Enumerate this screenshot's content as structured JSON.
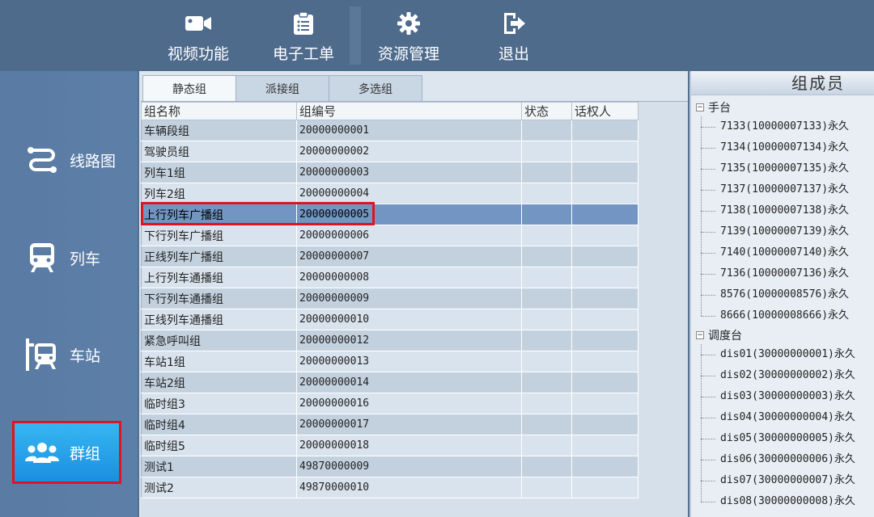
{
  "topbar": {
    "buttons": [
      {
        "label": "视频功能",
        "icon": "video-camera-icon"
      },
      {
        "label": "电子工单",
        "icon": "clipboard-icon"
      },
      {
        "label": "资源管理",
        "icon": "gear-icon"
      },
      {
        "label": "退出",
        "icon": "exit-icon"
      }
    ]
  },
  "sidebar": {
    "items": [
      {
        "label": "线路图",
        "icon": "route-icon"
      },
      {
        "label": "列车",
        "icon": "train-icon"
      },
      {
        "label": "车站",
        "icon": "station-icon"
      },
      {
        "label": "群组",
        "icon": "group-users-icon",
        "active": true
      }
    ]
  },
  "tabs": [
    {
      "label": "静态组",
      "active": true
    },
    {
      "label": "派接组"
    },
    {
      "label": "多选组"
    }
  ],
  "table": {
    "columns": [
      "组名称",
      "组编号",
      "状态",
      "话权人"
    ],
    "rows": [
      {
        "name": "车辆段组",
        "id": "20000000001",
        "status": "",
        "speaker": ""
      },
      {
        "name": "驾驶员组",
        "id": "20000000002",
        "status": "",
        "speaker": ""
      },
      {
        "name": "列车1组",
        "id": "20000000003",
        "status": "",
        "speaker": ""
      },
      {
        "name": "列车2组",
        "id": "20000000004",
        "status": "",
        "speaker": ""
      },
      {
        "name": "上行列车广播组",
        "id": "20000000005",
        "status": "",
        "speaker": "",
        "selected": true
      },
      {
        "name": "下行列车广播组",
        "id": "20000000006",
        "status": "",
        "speaker": ""
      },
      {
        "name": "正线列车广播组",
        "id": "20000000007",
        "status": "",
        "speaker": ""
      },
      {
        "name": "上行列车通播组",
        "id": "20000000008",
        "status": "",
        "speaker": ""
      },
      {
        "name": "下行列车通播组",
        "id": "20000000009",
        "status": "",
        "speaker": ""
      },
      {
        "name": "正线列车通播组",
        "id": "20000000010",
        "status": "",
        "speaker": ""
      },
      {
        "name": "紧急呼叫组",
        "id": "20000000012",
        "status": "",
        "speaker": ""
      },
      {
        "name": "车站1组",
        "id": "20000000013",
        "status": "",
        "speaker": ""
      },
      {
        "name": "车站2组",
        "id": "20000000014",
        "status": "",
        "speaker": ""
      },
      {
        "name": "临时组3",
        "id": "20000000016",
        "status": "",
        "speaker": ""
      },
      {
        "name": "临时组4",
        "id": "20000000017",
        "status": "",
        "speaker": ""
      },
      {
        "name": "临时组5",
        "id": "20000000018",
        "status": "",
        "speaker": ""
      },
      {
        "name": "测试1",
        "id": "49870000009",
        "status": "",
        "speaker": ""
      },
      {
        "name": "测试2",
        "id": "49870000010",
        "status": "",
        "speaker": ""
      }
    ]
  },
  "members": {
    "title": "组成员",
    "groups": [
      {
        "label": "手台",
        "toggle": "−",
        "items": [
          "7133(10000007133)永久",
          "7134(10000007134)永久",
          "7135(10000007135)永久",
          "7137(10000007137)永久",
          "7138(10000007138)永久",
          "7139(10000007139)永久",
          "7140(10000007140)永久",
          "7136(10000007136)永久",
          "8576(10000008576)永久",
          "8666(10000008666)永久"
        ]
      },
      {
        "label": "调度台",
        "toggle": "−",
        "items": [
          "dis01(30000000001)永久",
          "dis02(30000000002)永久",
          "dis03(30000000003)永久",
          "dis04(30000000004)永久",
          "dis05(30000000005)永久",
          "dis06(30000000006)永久",
          "dis07(30000000007)永久",
          "dis08(30000000008)永久"
        ]
      }
    ]
  },
  "colors": {
    "topbar": "#4f6b8c",
    "sidebar": "#5a7ba3",
    "active_item": "#1b8fe0",
    "highlight_border": "#e0141e",
    "selected_row": "#7395c4"
  }
}
